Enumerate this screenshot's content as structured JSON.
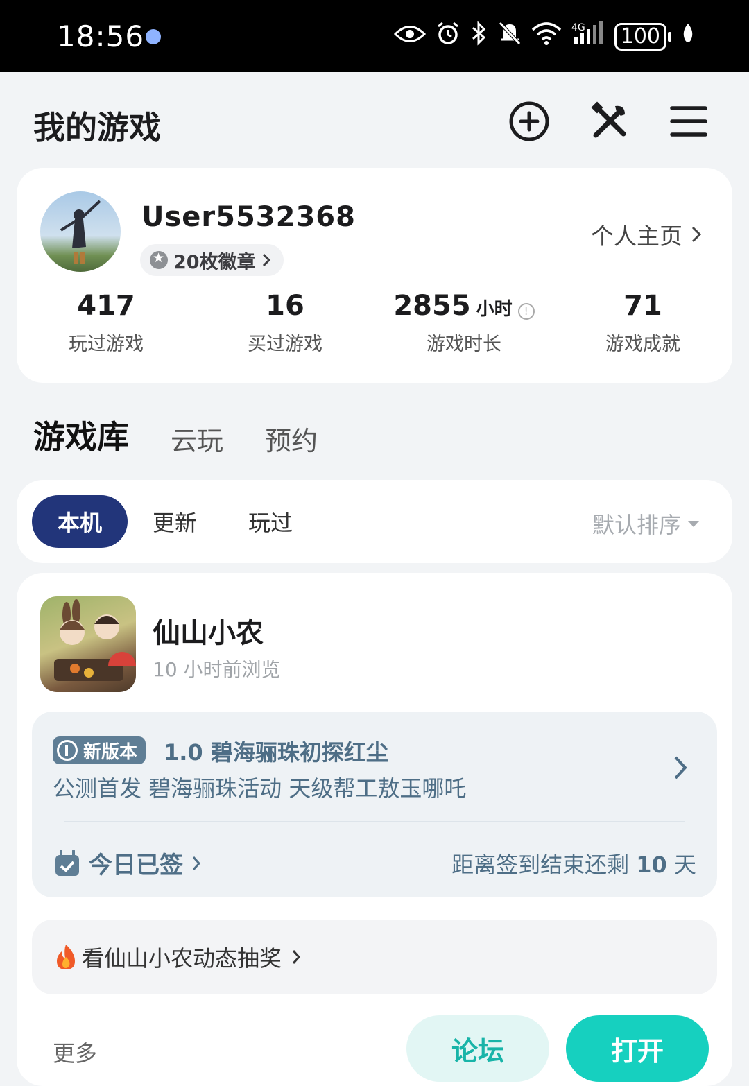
{
  "status_bar": {
    "time": "18:56",
    "battery": "100",
    "network": "4G"
  },
  "header": {
    "title": "我的游戏"
  },
  "profile": {
    "username": "User5532368",
    "badges": "20枚徽章",
    "homepage_link": "个人主页",
    "stats": [
      {
        "value": "417",
        "unit": "",
        "label": "玩过游戏"
      },
      {
        "value": "16",
        "unit": "",
        "label": "买过游戏"
      },
      {
        "value": "2855",
        "unit": "小时",
        "label": "游戏时长"
      },
      {
        "value": "71",
        "unit": "",
        "label": "游戏成就"
      }
    ]
  },
  "tabs": [
    {
      "label": "游戏库",
      "active": true
    },
    {
      "label": "云玩",
      "active": false
    },
    {
      "label": "预约",
      "active": false
    }
  ],
  "filters": {
    "chips": [
      "本机",
      "更新",
      "玩过"
    ],
    "active": "本机",
    "sort": "默认排序"
  },
  "game": {
    "name": "仙山小农",
    "last_viewed": "10 小时前浏览",
    "new_version_tag": "新版本",
    "version_title": "1.0 碧海骊珠初探红尘",
    "version_desc": "公测首发 碧海骊珠活动 天级帮工敖玉哪吒",
    "signed_today": "今日已签",
    "sign_remaining_prefix": "距离签到结束还剩",
    "sign_remaining_days": "10",
    "sign_remaining_suffix": "天",
    "promo": "看仙山小农动态抽奖",
    "more": "更多",
    "forum_button": "论坛",
    "open_button": "打开"
  },
  "colors": {
    "accent_teal": "#16d0bf",
    "active_chip": "#22357a",
    "update_text": "#4e6e86"
  }
}
